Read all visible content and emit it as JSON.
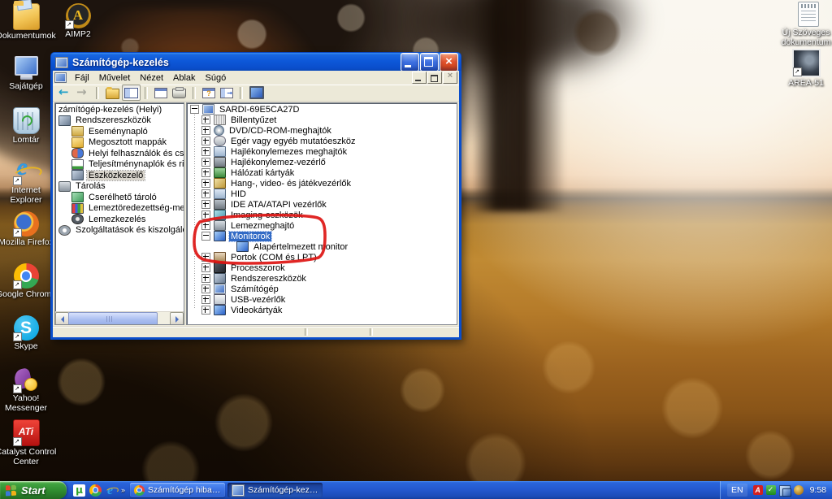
{
  "desktop": {
    "icons_left": [
      {
        "label": "Dokumentumok",
        "icon": "documents-folder-icon"
      },
      {
        "label": "Sajátgép",
        "icon": "my-computer-icon"
      },
      {
        "label": "Lomtár",
        "icon": "recycle-bin-icon"
      },
      {
        "label": "Internet Explorer",
        "icon": "internet-explorer-icon",
        "shortcut": true
      },
      {
        "label": "Mozilla Firefox",
        "icon": "firefox-icon",
        "shortcut": true
      },
      {
        "label": "Google Chrome",
        "icon": "chrome-icon",
        "shortcut": true
      },
      {
        "label": "Skype",
        "icon": "skype-icon",
        "shortcut": true
      },
      {
        "label": "Yahoo! Messenger",
        "icon": "yahoo-messenger-icon",
        "shortcut": true
      },
      {
        "label": "Catalyst Control Center",
        "icon": "ati-catalyst-icon",
        "shortcut": true
      }
    ],
    "icon_aimp": [
      {
        "label": "AIMP2",
        "icon": "aimp2-icon",
        "shortcut": true
      }
    ],
    "icons_right": [
      {
        "label": "Új Szöveges dokumentum",
        "icon": "text-document-icon"
      },
      {
        "label": "AREA-51",
        "icon": "area51-image-icon",
        "shortcut": true
      }
    ]
  },
  "window": {
    "title": "Számítógép-kezelés",
    "menus": [
      "Fájl",
      "Művelet",
      "Nézet",
      "Ablak",
      "Súgó"
    ],
    "toolbar": [
      {
        "icon": "back-arrow-icon"
      },
      {
        "icon": "forward-arrow-icon"
      },
      {
        "icon": "toolbar-separator"
      },
      {
        "icon": "up-folder-icon"
      },
      {
        "icon": "show-tree-icon",
        "pressed": true
      },
      {
        "icon": "toolbar-separator"
      },
      {
        "icon": "properties-icon"
      },
      {
        "icon": "print-icon"
      },
      {
        "icon": "toolbar-separator"
      },
      {
        "icon": "help-icon"
      },
      {
        "icon": "export-list-icon"
      },
      {
        "icon": "toolbar-separator"
      },
      {
        "icon": "remote-desktop-icon"
      }
    ],
    "left_tree": [
      {
        "label": "zámítógép-kezelés (Helyi)",
        "depth": 0,
        "root": true
      },
      {
        "label": "Rendszereszközök",
        "depth": 0,
        "icon": "system-tools-icon"
      },
      {
        "label": "Eseménynapló",
        "depth": 1,
        "icon": "event-log-icon"
      },
      {
        "label": "Megosztott mappák",
        "depth": 1,
        "icon": "shared-folders-icon"
      },
      {
        "label": "Helyi felhasználók és csoportok",
        "depth": 1,
        "icon": "users-icon"
      },
      {
        "label": "Teljesítménynaplók és riasztások",
        "depth": 1,
        "icon": "performance-icon"
      },
      {
        "label": "Eszközkezelő",
        "depth": 1,
        "icon": "device-manager-icon",
        "sel": "grey"
      },
      {
        "label": "Tárolás",
        "depth": 0,
        "icon": "storage-icon"
      },
      {
        "label": "Cserélhető tároló",
        "depth": 1,
        "icon": "removable-storage-icon"
      },
      {
        "label": "Lemeztöredezettség-mentesítő",
        "depth": 1,
        "icon": "defrag-icon"
      },
      {
        "label": "Lemezkezelés",
        "depth": 1,
        "icon": "disk-management-icon"
      },
      {
        "label": "Szolgáltatások és kiszolgálói alkalmazások",
        "depth": 0,
        "icon": "services-icon"
      }
    ],
    "right_tree": [
      {
        "label": "SARDI-69E5CA27D",
        "depth": 0,
        "expand": "minus",
        "icon": "sardi-computer-icon"
      },
      {
        "label": "Billentyűzet",
        "depth": 1,
        "expand": "plus",
        "icon": "keyboard-icon"
      },
      {
        "label": "DVD/CD-ROM-meghajtók",
        "depth": 1,
        "expand": "plus",
        "icon": "dvd-drive-icon"
      },
      {
        "label": "Egér vagy egyéb mutatóeszköz",
        "depth": 1,
        "expand": "plus",
        "icon": "mouse-icon"
      },
      {
        "label": "Hajlékonylemezes meghajtók",
        "depth": 1,
        "expand": "plus",
        "icon": "floppy-drive-icon"
      },
      {
        "label": "Hajlékonylemez-vezérlő",
        "depth": 1,
        "expand": "plus",
        "icon": "floppy-controller-icon"
      },
      {
        "label": "Hálózati kártyák",
        "depth": 1,
        "expand": "plus",
        "icon": "network-adapter-icon"
      },
      {
        "label": "Hang-, video- és játékvezérlők",
        "depth": 1,
        "expand": "plus",
        "icon": "sound-icon"
      },
      {
        "label": "HID",
        "depth": 1,
        "expand": "plus",
        "icon": "hid-icon"
      },
      {
        "label": "IDE ATA/ATAPI vezérlők",
        "depth": 1,
        "expand": "plus",
        "icon": "ide-controller-icon"
      },
      {
        "label": "Imaging-eszközök",
        "depth": 1,
        "expand": "plus",
        "icon": "imaging-icon"
      },
      {
        "label": "Lemezmeghajtó",
        "depth": 1,
        "expand": "plus",
        "icon": "disk-drive-icon"
      },
      {
        "label": "Monitorok",
        "depth": 1,
        "expand": "minus",
        "icon": "monitor-icon",
        "sel": "blue"
      },
      {
        "label": "Alapértelmezett monitor",
        "depth": 2,
        "expand": "none",
        "icon": "monitor-icon"
      },
      {
        "label": "Portok (COM és LPT)",
        "depth": 1,
        "expand": "plus",
        "icon": "ports-icon"
      },
      {
        "label": "Processzorok",
        "depth": 1,
        "expand": "plus",
        "icon": "cpu-icon"
      },
      {
        "label": "Rendszereszközök",
        "depth": 1,
        "expand": "plus",
        "icon": "system-devices-icon"
      },
      {
        "label": "Számítógép",
        "depth": 1,
        "expand": "plus",
        "icon": "computer-node-icon"
      },
      {
        "label": "USB-vezérlők",
        "depth": 1,
        "expand": "plus",
        "icon": "usb-icon"
      },
      {
        "label": "Videokártyák",
        "depth": 1,
        "expand": "plus",
        "icon": "gpu-icon"
      }
    ]
  },
  "taskbar": {
    "start_label": "Start",
    "quick_launch": [
      {
        "icon": "utorrent-icon"
      },
      {
        "icon": "chrome-icon"
      },
      {
        "icon": "internet-explorer-icon"
      }
    ],
    "overflow_chevron": "»",
    "buttons": [
      {
        "label": "Számítógép hiba, de ...",
        "icon": "chrome-icon"
      },
      {
        "label": "Számítógép-kezelés",
        "icon": "computer-management-icon",
        "active": true
      }
    ],
    "tray": {
      "language": "EN",
      "icons": [
        {
          "icon": "ati-tray-icon"
        },
        {
          "icon": "antivirus-check-icon"
        },
        {
          "icon": "network-tray-icon"
        },
        {
          "icon": "volume-tray-icon"
        }
      ],
      "time": "9:58"
    }
  },
  "annotation": {
    "color": "#dd1512",
    "target": "Monitorok group"
  }
}
